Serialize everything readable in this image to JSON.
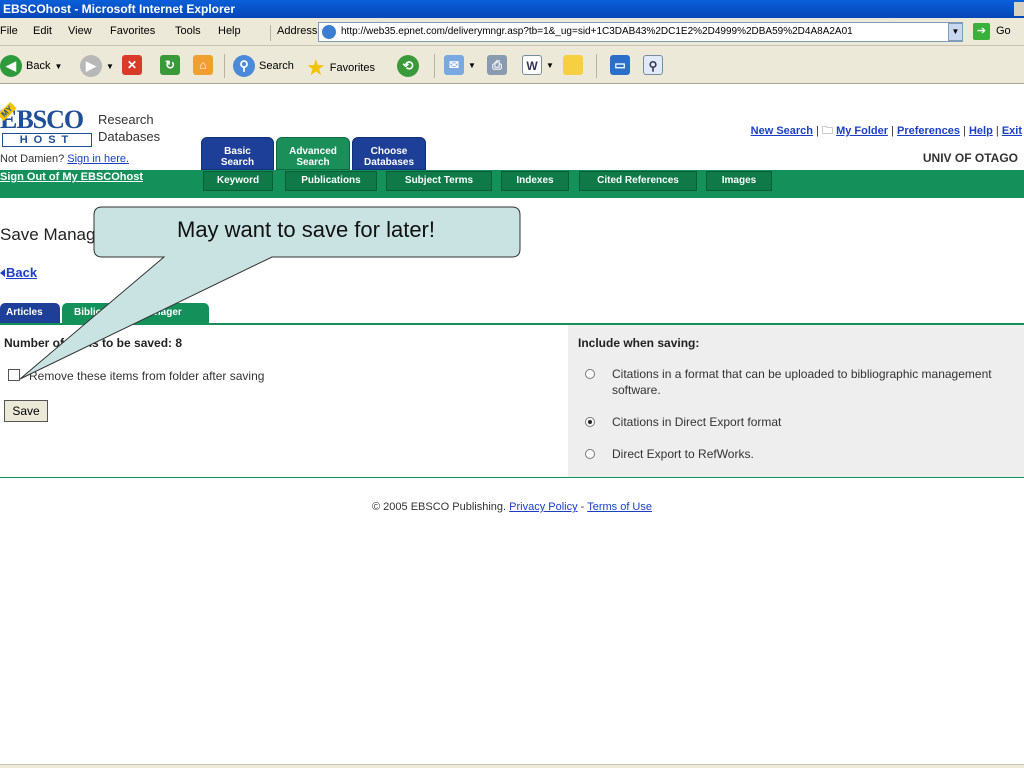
{
  "window": {
    "title": "EBSCOhost - Microsoft Internet Explorer"
  },
  "menu": [
    "File",
    "Edit",
    "View",
    "Favorites",
    "Tools",
    "Help"
  ],
  "address": {
    "label": "Address",
    "url": "http://web35.epnet.com/deliverymngr.asp?tb=1&_ug=sid+1C3DAB43%2DC1E2%2D4999%2DBA59%2D4A8A2A01",
    "go": "Go"
  },
  "toolbar": {
    "back": "Back",
    "search": "Search",
    "favorites": "Favorites"
  },
  "header": {
    "logo_text": "EBSCO",
    "logo_host": "HOST",
    "logo_badge": "MY",
    "research": "Research",
    "databases": "Databases",
    "not_user": "Not Damien?",
    "sign_in": "Sign in here.",
    "tabs": [
      {
        "line1": "Basic",
        "line2": "Search"
      },
      {
        "line1": "Advanced",
        "line2": "Search"
      },
      {
        "line1": "Choose",
        "line2": "Databases"
      }
    ],
    "links": {
      "new_search": "New Search",
      "my_folder": "My Folder",
      "preferences": "Preferences",
      "help": "Help",
      "exit": "Exit",
      "sep": "|"
    },
    "institution": "UNIV OF OTAGO",
    "sign_out": "Sign Out of My EBSCOhost",
    "subtabs": [
      "Keyword",
      "Publications",
      "Subject Terms",
      "Indexes",
      "Cited References",
      "Images"
    ]
  },
  "main": {
    "title": "Save Manager",
    "back": "Back",
    "tabs": [
      "Articles",
      "Bibliographic Manager"
    ],
    "num_items": "Number of items to be saved: 8",
    "remove_label": "Remove these items from folder after saving",
    "save_button": "Save",
    "include_title": "Include when saving:",
    "options": [
      "Citations in a format that can be uploaded to bibliographic management software.",
      "Citations in Direct Export format",
      "Direct Export to RefWorks."
    ]
  },
  "footer": {
    "copyright": "© 2005 EBSCO Publishing.",
    "privacy": "Privacy Policy",
    "dash": "-",
    "terms": "Terms of Use"
  },
  "callout": {
    "text": "May want to save for later!"
  }
}
